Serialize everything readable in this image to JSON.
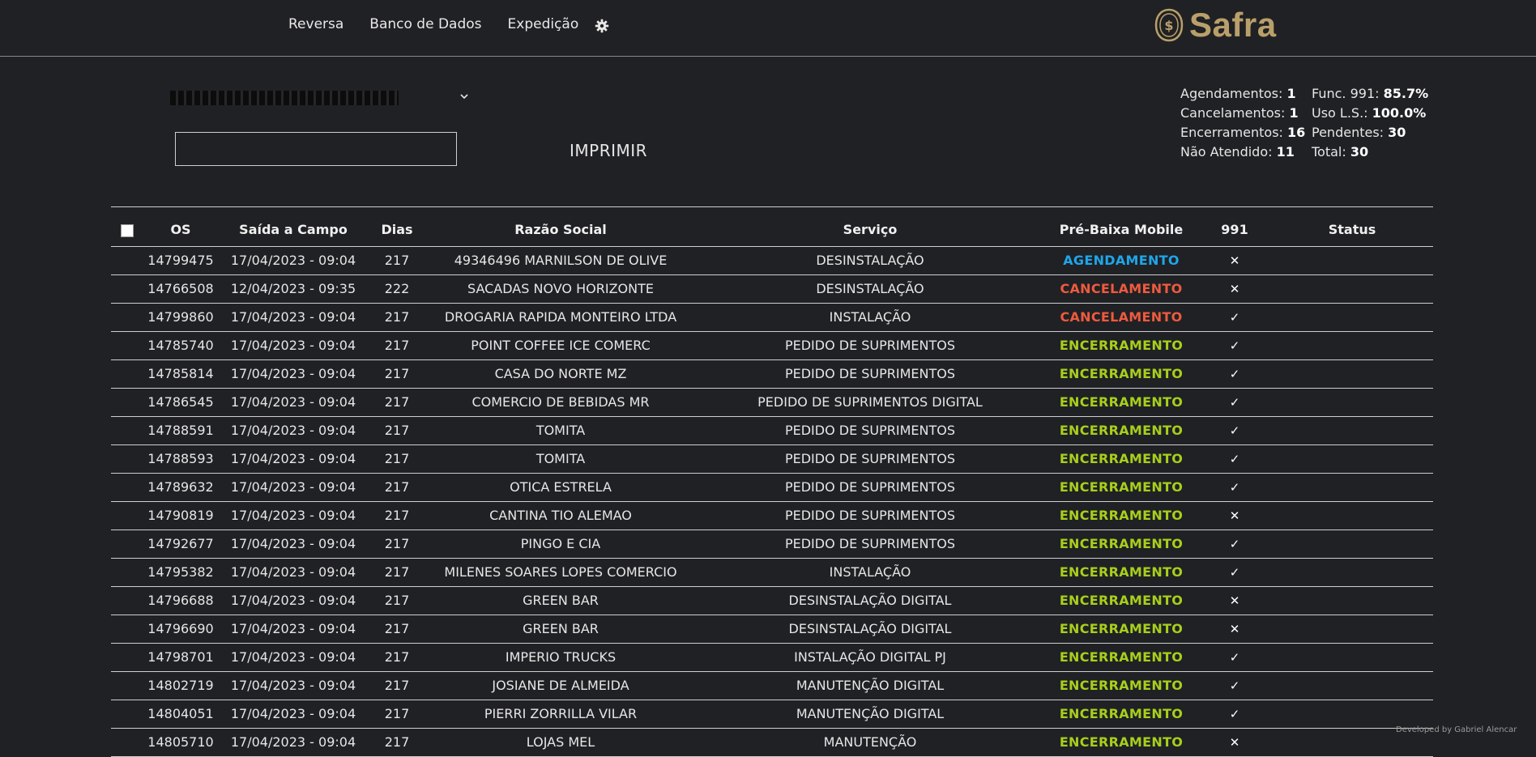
{
  "nav": {
    "items": [
      "Reversa",
      "Banco de Dados",
      "Expedição"
    ],
    "settings_icon": "gear-icon"
  },
  "logo": {
    "text": "Safra",
    "icon": "safra-seal-icon",
    "color": "#b9a06a"
  },
  "filter": {
    "selected_text": "REDACTED",
    "search_value": "",
    "print_label": "IMPRIMIR"
  },
  "stats": {
    "col1": [
      {
        "label": "Agendamentos:",
        "value": "1"
      },
      {
        "label": "Cancelamentos:",
        "value": "1"
      },
      {
        "label": "Encerramentos:",
        "value": "16"
      },
      {
        "label": "Não Atendido:",
        "value": "11"
      }
    ],
    "col2": [
      {
        "label": "Func. 991:",
        "value": "85.7%"
      },
      {
        "label": "Uso L.S.:",
        "value": "100.0%"
      },
      {
        "label": "Pendentes:",
        "value": "30"
      },
      {
        "label": "Total:",
        "value": "30"
      }
    ]
  },
  "table": {
    "headers": [
      "OS",
      "Saída a Campo",
      "Dias",
      "Razão Social",
      "Serviço",
      "Pré-Baixa Mobile",
      "991",
      "Status"
    ],
    "rows": [
      {
        "os": "14799475",
        "saida": "17/04/2023 - 09:04",
        "dias": "217",
        "razao": "49346496 MARNILSON DE OLIVE",
        "servico": "DESINSTALAÇÃO",
        "prebaixa": "AGENDAMENTO",
        "f991": "✕",
        "status": ""
      },
      {
        "os": "14766508",
        "saida": "12/04/2023 - 09:35",
        "dias": "222",
        "razao": "SACADAS NOVO HORIZONTE",
        "servico": "DESINSTALAÇÃO",
        "prebaixa": "CANCELAMENTO",
        "f991": "✕",
        "status": ""
      },
      {
        "os": "14799860",
        "saida": "17/04/2023 - 09:04",
        "dias": "217",
        "razao": "DROGARIA RAPIDA MONTEIRO LTDA",
        "servico": "INSTALAÇÃO",
        "prebaixa": "CANCELAMENTO",
        "f991": "✓",
        "status": ""
      },
      {
        "os": "14785740",
        "saida": "17/04/2023 - 09:04",
        "dias": "217",
        "razao": "POINT COFFEE ICE COMERC",
        "servico": "PEDIDO DE SUPRIMENTOS",
        "prebaixa": "ENCERRAMENTO",
        "f991": "✓",
        "status": ""
      },
      {
        "os": "14785814",
        "saida": "17/04/2023 - 09:04",
        "dias": "217",
        "razao": "CASA DO NORTE MZ",
        "servico": "PEDIDO DE SUPRIMENTOS",
        "prebaixa": "ENCERRAMENTO",
        "f991": "✓",
        "status": ""
      },
      {
        "os": "14786545",
        "saida": "17/04/2023 - 09:04",
        "dias": "217",
        "razao": "COMERCIO DE BEBIDAS MR",
        "servico": "PEDIDO DE SUPRIMENTOS DIGITAL",
        "prebaixa": "ENCERRAMENTO",
        "f991": "✓",
        "status": ""
      },
      {
        "os": "14788591",
        "saida": "17/04/2023 - 09:04",
        "dias": "217",
        "razao": "TOMITA",
        "servico": "PEDIDO DE SUPRIMENTOS",
        "prebaixa": "ENCERRAMENTO",
        "f991": "✓",
        "status": ""
      },
      {
        "os": "14788593",
        "saida": "17/04/2023 - 09:04",
        "dias": "217",
        "razao": "TOMITA",
        "servico": "PEDIDO DE SUPRIMENTOS",
        "prebaixa": "ENCERRAMENTO",
        "f991": "✓",
        "status": ""
      },
      {
        "os": "14789632",
        "saida": "17/04/2023 - 09:04",
        "dias": "217",
        "razao": "OTICA ESTRELA",
        "servico": "PEDIDO DE SUPRIMENTOS",
        "prebaixa": "ENCERRAMENTO",
        "f991": "✓",
        "status": ""
      },
      {
        "os": "14790819",
        "saida": "17/04/2023 - 09:04",
        "dias": "217",
        "razao": "CANTINA TIO ALEMAO",
        "servico": "PEDIDO DE SUPRIMENTOS",
        "prebaixa": "ENCERRAMENTO",
        "f991": "✕",
        "status": ""
      },
      {
        "os": "14792677",
        "saida": "17/04/2023 - 09:04",
        "dias": "217",
        "razao": "PINGO E CIA",
        "servico": "PEDIDO DE SUPRIMENTOS",
        "prebaixa": "ENCERRAMENTO",
        "f991": "✓",
        "status": ""
      },
      {
        "os": "14795382",
        "saida": "17/04/2023 - 09:04",
        "dias": "217",
        "razao": "MILENES SOARES LOPES COMERCIO",
        "servico": "INSTALAÇÃO",
        "prebaixa": "ENCERRAMENTO",
        "f991": "✓",
        "status": ""
      },
      {
        "os": "14796688",
        "saida": "17/04/2023 - 09:04",
        "dias": "217",
        "razao": "GREEN BAR",
        "servico": "DESINSTALAÇÃO DIGITAL",
        "prebaixa": "ENCERRAMENTO",
        "f991": "✕",
        "status": ""
      },
      {
        "os": "14796690",
        "saida": "17/04/2023 - 09:04",
        "dias": "217",
        "razao": "GREEN BAR",
        "servico": "DESINSTALAÇÃO DIGITAL",
        "prebaixa": "ENCERRAMENTO",
        "f991": "✕",
        "status": ""
      },
      {
        "os": "14798701",
        "saida": "17/04/2023 - 09:04",
        "dias": "217",
        "razao": "IMPERIO TRUCKS",
        "servico": "INSTALAÇÃO DIGITAL PJ",
        "prebaixa": "ENCERRAMENTO",
        "f991": "✓",
        "status": ""
      },
      {
        "os": "14802719",
        "saida": "17/04/2023 - 09:04",
        "dias": "217",
        "razao": "JOSIANE DE ALMEIDA",
        "servico": "MANUTENÇÃO DIGITAL",
        "prebaixa": "ENCERRAMENTO",
        "f991": "✓",
        "status": ""
      },
      {
        "os": "14804051",
        "saida": "17/04/2023 - 09:04",
        "dias": "217",
        "razao": "PIERRI ZORRILLA VILAR",
        "servico": "MANUTENÇÃO DIGITAL",
        "prebaixa": "ENCERRAMENTO",
        "f991": "✓",
        "status": ""
      },
      {
        "os": "14805710",
        "saida": "17/04/2023 - 09:04",
        "dias": "217",
        "razao": "LOJAS MEL",
        "servico": "MANUTENÇÃO",
        "prebaixa": "ENCERRAMENTO",
        "f991": "✕",
        "status": ""
      }
    ]
  },
  "colors": {
    "background": "#202124",
    "agendamento": "#1ea6ea",
    "cancelamento": "#ee5a3e",
    "encerramento": "#a7cf1b",
    "brand_gold": "#b9a06a"
  },
  "footer": {
    "credit": "Developed by Gabriel Alencar"
  }
}
